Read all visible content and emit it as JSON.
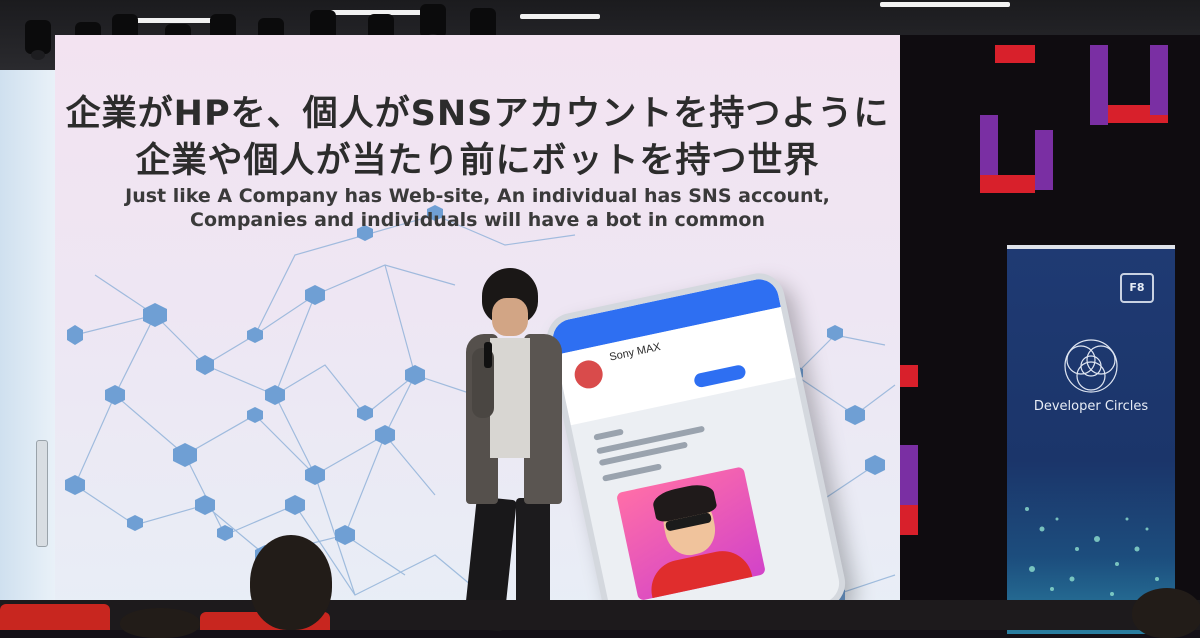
{
  "slide": {
    "title_line1": "企業がHPを、個人がSNSアカウントを持つように",
    "title_line2": "企業や個人が当たり前にボットを持つ世界",
    "subtitle_line1": "Just like A Company has Web-site, An individual has SNS account,",
    "subtitle_line2": "Companies and individuals will have a bot in common"
  },
  "phone": {
    "profile_name": "Sony MAX"
  },
  "banner": {
    "badge": "F8",
    "label": "Developer Circles"
  },
  "colors": {
    "slide_background": "#efe6f3",
    "network_nodes": "#6f9fd4",
    "phone_accent": "#2e6ff2",
    "banner_background": "#1f3a73",
    "wall_accent_red": "#d8202b",
    "wall_accent_purple": "#7a2fa3",
    "seat_red": "#c8261f"
  }
}
